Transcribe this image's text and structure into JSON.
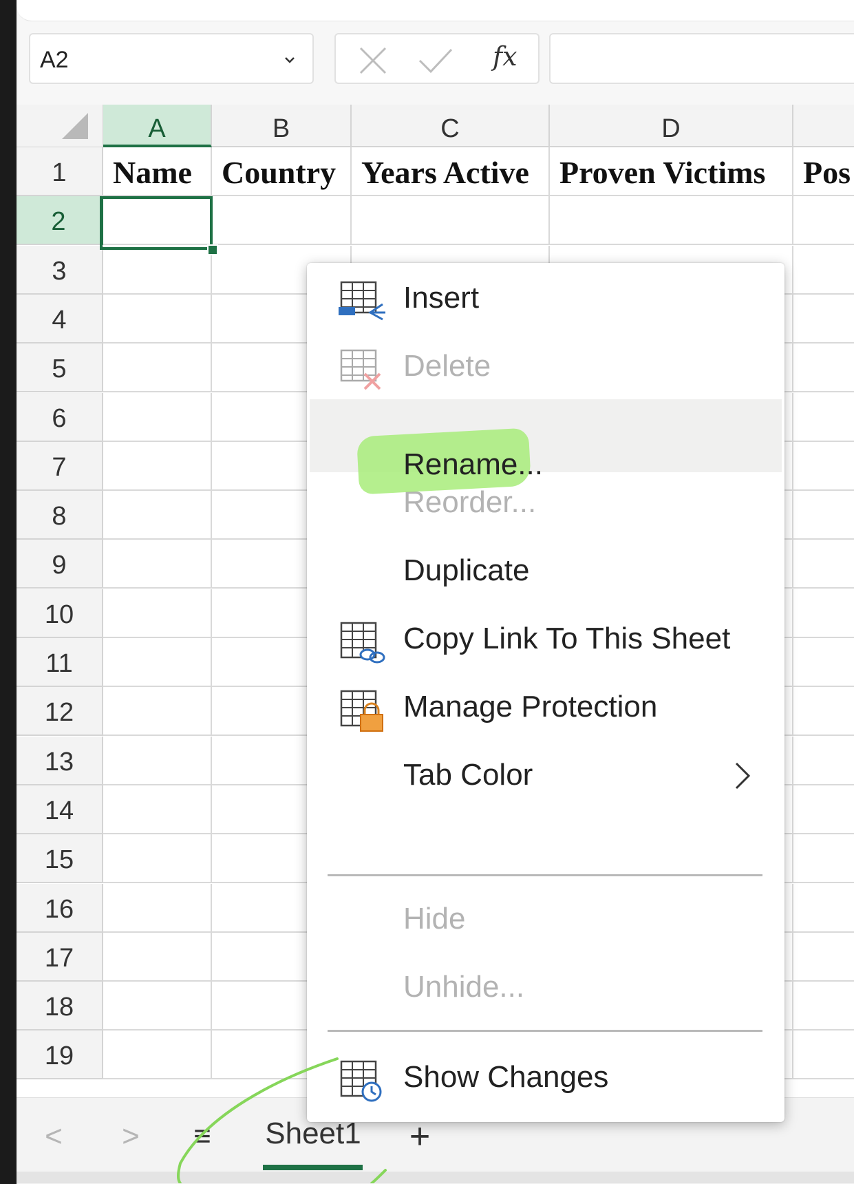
{
  "name_box": {
    "value": "A2"
  },
  "formula_bar": {
    "fx_label": "fx",
    "value": ""
  },
  "columns": [
    {
      "letter": "A",
      "selected": true
    },
    {
      "letter": "B",
      "selected": false
    },
    {
      "letter": "C",
      "selected": false
    },
    {
      "letter": "D",
      "selected": false
    },
    {
      "letter": "",
      "selected": false
    }
  ],
  "rows": [
    "1",
    "2",
    "3",
    "4",
    "5",
    "6",
    "7",
    "8",
    "9",
    "10",
    "11",
    "12",
    "13",
    "14",
    "15",
    "16",
    "17",
    "18",
    "19"
  ],
  "selected_row": "2",
  "header_row": [
    "Name",
    "Country",
    "Years Active",
    "Proven Victims",
    "Pos"
  ],
  "context_menu": {
    "items": [
      {
        "label": "Insert",
        "icon": "insert-sheet-icon",
        "enabled": true
      },
      {
        "label": "Delete",
        "icon": "delete-sheet-icon",
        "enabled": false
      },
      {
        "label": "Rename...",
        "icon": "",
        "enabled": true,
        "hovered": true
      },
      {
        "label": "Reorder...",
        "icon": "",
        "enabled": false
      },
      {
        "label": "Duplicate",
        "icon": "",
        "enabled": true
      },
      {
        "label": "Copy Link To This Sheet",
        "icon": "link-sheet-icon",
        "enabled": true
      },
      {
        "label": "Manage Protection",
        "icon": "lock-sheet-icon",
        "enabled": true
      },
      {
        "label": "Tab Color",
        "icon": "",
        "enabled": true,
        "submenu": true
      },
      {
        "label": "Hide",
        "icon": "",
        "enabled": false
      },
      {
        "label": "Unhide...",
        "icon": "",
        "enabled": false
      },
      {
        "label": "Show Changes",
        "icon": "history-sheet-icon",
        "enabled": true
      }
    ]
  },
  "sheet_bar": {
    "prev": "<",
    "next": ">",
    "menu_glyph": "≡",
    "active_sheet": "Sheet1",
    "add_glyph": "+"
  },
  "colors": {
    "accent_green": "#1e7145",
    "selected_header": "#cfe9d8",
    "annotation_highlight": "#a8ec7a"
  }
}
